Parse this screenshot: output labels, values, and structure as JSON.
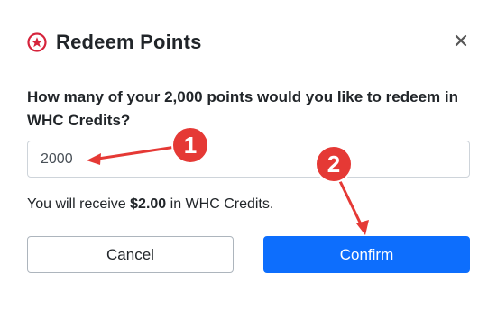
{
  "dialog": {
    "title": "Redeem Points",
    "question": "How many of your 2,000 points would you like to redeem in WHC Credits?",
    "input": {
      "value": "2000",
      "placeholder": ""
    },
    "receive": {
      "prefix": "You will receive ",
      "amount": "$2.00",
      "suffix": " in WHC Credits."
    },
    "buttons": {
      "cancel": "Cancel",
      "confirm": "Confirm"
    },
    "icons": {
      "title_icon": "star-circle-icon",
      "close_icon": "close-icon"
    }
  },
  "annotations": {
    "badges": [
      "1",
      "2"
    ],
    "color": "#e53935"
  },
  "colors": {
    "accent": "#0d6efd",
    "star": "#d6243c",
    "annotation": "#e53935"
  }
}
